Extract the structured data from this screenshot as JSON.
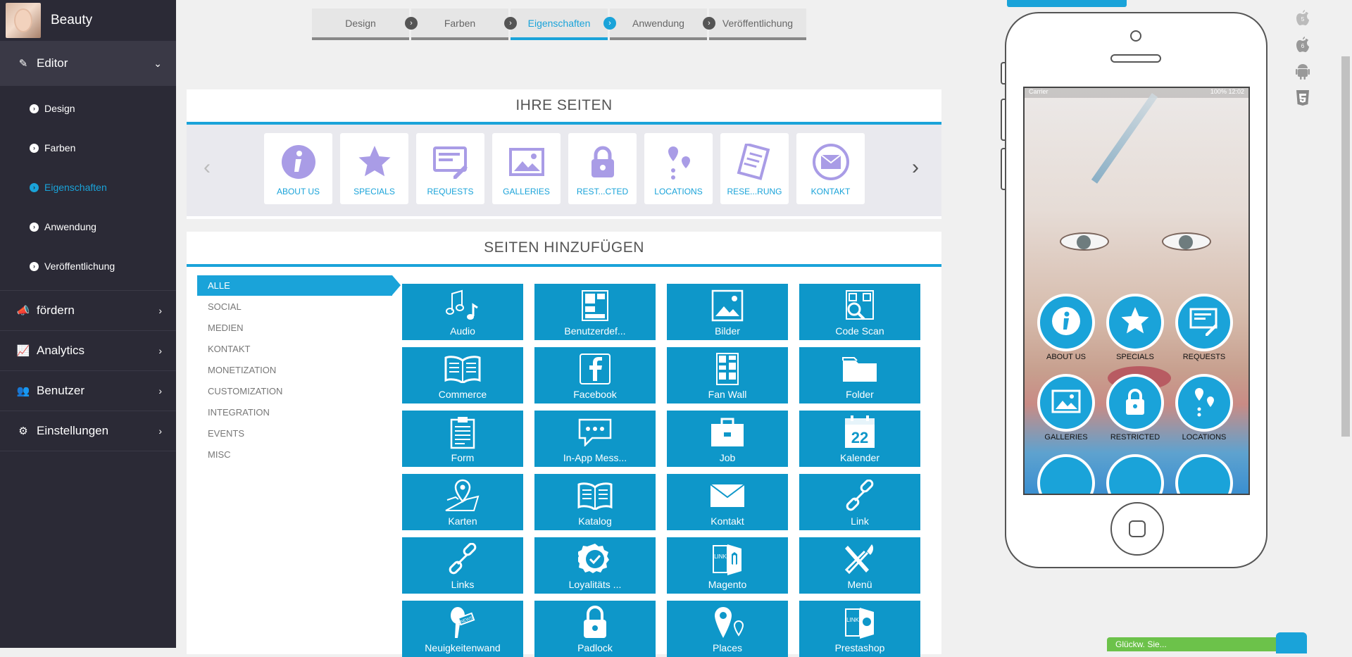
{
  "brand": {
    "name": "Beauty"
  },
  "sidebar": {
    "editor": {
      "label": "Editor",
      "items": [
        "Design",
        "Farben",
        "Eigenschaften",
        "Anwendung",
        "Veröffentlichung"
      ]
    },
    "menus": [
      {
        "label": "fördern",
        "icon": "megaphone-icon"
      },
      {
        "label": "Analytics",
        "icon": "chart-icon"
      },
      {
        "label": "Benutzer",
        "icon": "users-icon"
      },
      {
        "label": "Einstellungen",
        "icon": "gears-icon"
      }
    ]
  },
  "steps": [
    "Design",
    "Farben",
    "Eigenschaften",
    "Anwendung",
    "Veröffentlichung"
  ],
  "active_step": "Eigenschaften",
  "your_pages": {
    "title": "IHRE SEITEN",
    "items": [
      "ABOUT US",
      "SPECIALS",
      "REQUESTS",
      "GALLERIES",
      "REST...CTED",
      "LOCATIONS",
      "RESE...RUNG",
      "KONTAKT"
    ]
  },
  "add_pages": {
    "title": "SEITEN HINZUFÜGEN",
    "categories": [
      "ALLE",
      "SOCIAL",
      "MEDIEN",
      "KONTAKT",
      "MONETIZATION",
      "CUSTOMIZATION",
      "INTEGRATION",
      "EVENTS",
      "MISC"
    ],
    "tiles": [
      "Audio",
      "Benutzerdef...",
      "Bilder",
      "Code Scan",
      "Commerce",
      "Facebook",
      "Fan Wall",
      "Folder",
      "Form",
      "In-App Mess...",
      "Job",
      "Kalender",
      "Karten",
      "Katalog",
      "Kontakt",
      "Link",
      "Links",
      "Loyalitäts ...",
      "Magento",
      "Menü",
      "Neuigkeitenwand",
      "Padlock",
      "Places",
      "Prestashop"
    ]
  },
  "phone": {
    "carrier": "Carrier",
    "battery": "100%",
    "time": "12:02",
    "apps": [
      "ABOUT US",
      "SPECIALS",
      "REQUESTS",
      "GALLERIES",
      "RESTRICTED",
      "LOCATIONS"
    ]
  },
  "os_icons": [
    "apple-ios5-icon",
    "apple-ios6-icon",
    "android-icon",
    "html5-icon"
  ],
  "toast": {
    "text": "Glückw. Sie... "
  },
  "colors": {
    "accent": "#1aa3d9",
    "tile": "#0e97c9",
    "sidebar": "#2b2a36",
    "icon_purple": "#a99ce6"
  }
}
